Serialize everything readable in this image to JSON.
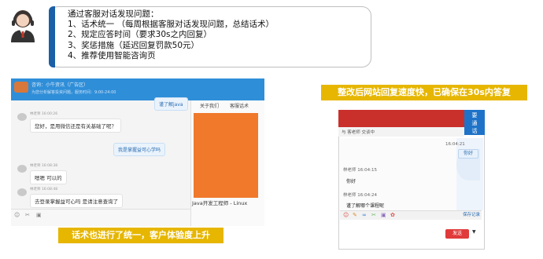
{
  "header": {
    "lines": [
      "通过客服对话发现问题：",
      "1、话术统一 （每周根据客服对话发现问题，总结话术）",
      "2、规定应答时间（要求30s之内回复）",
      "3、奖惩措施（延迟回复罚款50元）",
      "4、推荐使用智能咨询页"
    ]
  },
  "left_chat": {
    "banner": "话术也进行了统一，客户体验度上升",
    "header_line1": "咨询：小牛资讯（广告区）",
    "header_line2": "为您分析解答投资问题，服务时间：9:00-24:00",
    "messages": [
      {
        "type": "agent",
        "text": "您好，是用微信还是有关基础了呢？",
        "time": "16:00:26"
      },
      {
        "type": "user",
        "text": "我是掌握益可心学吗"
      },
      {
        "type": "agent",
        "text": "嗯嗯  可以的",
        "time": "16:08:38"
      },
      {
        "type": "agent",
        "text": "去登录掌握益可心吗 是请注意查询了",
        "time": "16:08:48"
      }
    ],
    "top_right_bubble": "谨了解java",
    "side_tabs": [
      "关于我们",
      "客服话术"
    ],
    "side_caption": "Java开发工程师 - Linux",
    "agent_name": "林老师"
  },
  "right_chat": {
    "banner": "整改后网站回复速度快，已确保在30s内答复",
    "corner_badge_line1": "要",
    "corner_badge_line2": "通",
    "corner_badge_line3": "话",
    "sub_bar": "与 客老师 交谈中",
    "user_time": "16:04:21",
    "user_text": "你好",
    "agent_name": "林老师",
    "messages": [
      {
        "time": "16:04:15",
        "text": "你好"
      },
      {
        "time": "16:04:24",
        "text": "谨了解哪个课程呢"
      }
    ],
    "link": "保存记录",
    "send": "发送"
  },
  "colors": {
    "accent_blue": "#1a5fa8",
    "banner_yellow": "#e6b600",
    "chat_blue": "#2f8ed8",
    "red": "#c9302c"
  }
}
